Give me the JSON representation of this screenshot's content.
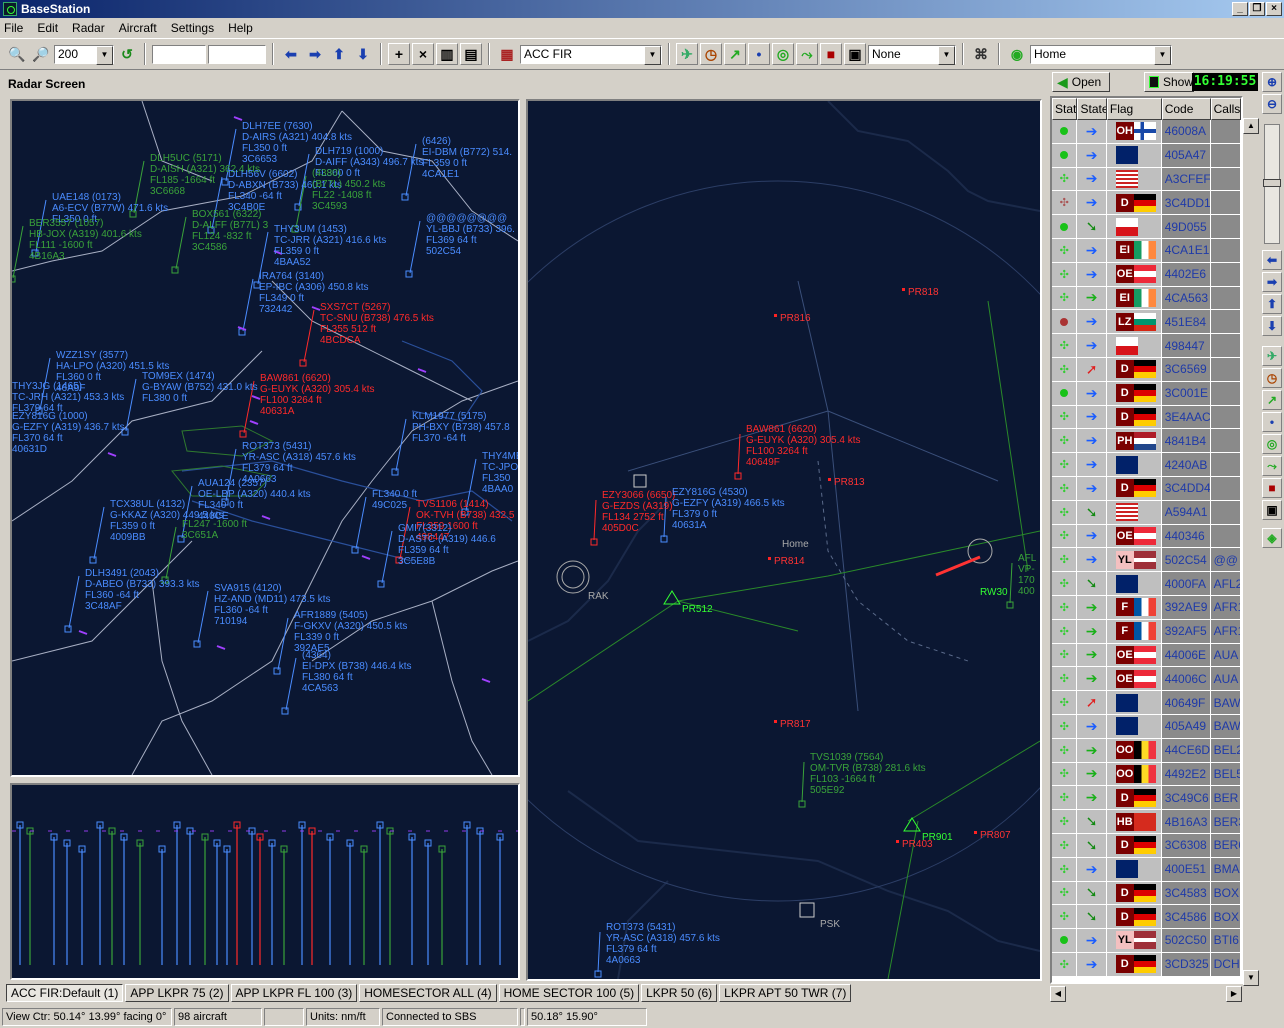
{
  "app": {
    "title": "BaseStation"
  },
  "menu": [
    "File",
    "Edit",
    "Radar",
    "Aircraft",
    "Settings",
    "Help"
  ],
  "toolbar": {
    "zoom": "200",
    "fir": "ACC FIR",
    "filter": "None",
    "location": "Home"
  },
  "radar_label": "Radar Screen",
  "open_button": "Open",
  "show_button": "Show",
  "clock": "16:19:55",
  "colors": {
    "blue": "#4a8cff",
    "green": "#3aa33a",
    "red": "#ff2a2a",
    "bg": "#0b1732"
  },
  "left_targets": [
    {
      "c": "b",
      "t": "DLH7EE (7630)\nD-AIRS (A321) 404.8 kts\nFL350 0 ft\n3C6653"
    },
    {
      "c": "b",
      "t": "DLH719 (1000)\nD-AIFF (A343) 496.7 kts\nFL360 0 ft"
    },
    {
      "c": "b",
      "t": "(6426)\nEI-DBM (B772) 514.\nFL359 0 ft\n4CA1E1"
    },
    {
      "c": "g",
      "t": "DLH5UC (5171)\nD-AISH (A321) 362.4 kts\nFL185 -1664 ft\n3C6668"
    },
    {
      "c": "b",
      "t": "DLH56V (6602)\nD-ABXN (B733) 460.1 kts\nFL340 -64 ft\n3C4B0E"
    },
    {
      "c": "g",
      "t": "(4380)\n(B77L) 450.2 kts\nFL22 -1408 ft\n3C4593"
    },
    {
      "c": "b",
      "t": "UAE148 (0173)\nA6-ECV (B77W) 471.6 kts\nFL350 0 ft"
    },
    {
      "c": "g",
      "t": "BER3557 (1057)\nHB-JOX (A319) 401.6 kts\nFL111 -1600 ft\n4B16A3"
    },
    {
      "c": "g",
      "t": "BOX561 (6322)\nD-ALFF (B77L) 3\nFL124 -832 ft\n3C4586"
    },
    {
      "c": "b",
      "t": "THY3UM (1453)\nTC-JRR (A321) 416.6 kts\nFL359 0 ft\n4BAA52"
    },
    {
      "c": "b",
      "t": "@@@@@@@@\nYL-BBJ (B733) 396.\nFL369 64 ft\n502C54"
    },
    {
      "c": "b",
      "t": "IRA764 (3140)\nEP-IBC (A306) 450.8 kts\nFL349 0 ft\n732442"
    },
    {
      "c": "r",
      "t": "SXS7CT (5267)\nTC-SNU (B738) 476.5 kts\nFL355 512 ft\n4BCDCA"
    },
    {
      "c": "b",
      "t": "WZZ1SY (3577)\nHA-LPO (A320) 451.5 kts\nFL360 0 ft\n46A9F"
    },
    {
      "c": "b",
      "t": "TOM9EX (1474)\nG-BYAW (B752) 431.0 kts\nFL380 0 ft"
    },
    {
      "c": "b",
      "t": "THY3JG (1465)\nTC-JRH (A321) 453.3 kts\nFL379 64 ft"
    },
    {
      "c": "r",
      "t": "BAW861 (6620)\nG-EUYK (A320) 305.4 kts\nFL100 3264 ft\n40631A"
    },
    {
      "c": "b",
      "t": "KLM1977 (5175)\nPH-BXY (B738) 457.8\nFL370 -64 ft"
    },
    {
      "c": "b",
      "t": "EZY816G (1000)\nG-EZFY (A319) 436.7 kts\nFL370 64 ft\n40631D"
    },
    {
      "c": "b",
      "t": "ROT373 (5431)\nYR-ASC (A318) 457.6 kts\nFL379 64 ft\n4A0663"
    },
    {
      "c": "b",
      "t": "THY4ME\nTC-JPO\nFL350\n4BAA0"
    },
    {
      "c": "b",
      "t": "AUA124 (2357)\nOE-LBP (A320) 440.4 kts\nFL340 0 ft\n440CE"
    },
    {
      "c": "b",
      "t": "FL340 0 ft\n49C025"
    },
    {
      "c": "r",
      "t": "TVS1106 (1414)\nOK-TVH (B738) 432.5\nFL359 1600 ft\n498447"
    },
    {
      "c": "b",
      "t": "TCX38UL (4132)\nG-KKAZ (A320) 449.5 kts\nFL359 0 ft\n4009BB"
    },
    {
      "c": "g",
      "t": "FL247 -1600 ft\n3C651A"
    },
    {
      "c": "b",
      "t": "GMI7(3312)\nD-ASTC (A319) 446.6\nFL359 64 ft\n3C5E8B"
    },
    {
      "c": "b",
      "t": "DLH3491 (2043)\nD-ABEO (B733) 393.3 kts\nFL360 -64 ft\n3C48AF"
    },
    {
      "c": "b",
      "t": "SVA915 (4120)\nHZ-AND (MD11) 473.5 kts\nFL360 -64 ft\n710194"
    },
    {
      "c": "b",
      "t": "AFR1889 (5405)\nF-GKXV (A320) 450.5 kts\nFL339 0 ft\n392AE5"
    },
    {
      "c": "b",
      "t": "(4364)\nEI-DPX (B738) 446.4 kts\nFL380 64 ft\n4CA563"
    }
  ],
  "right_targets": [
    {
      "c": "r",
      "t": "BAW861 (6620)\nG-EUYK (A320) 305.4 kts\nFL100 3264 ft\n40649F"
    },
    {
      "c": "r",
      "t": "EZY3066 (6650)\nG-EZDS (A319)\nFL134 2752 ft\n405D0C"
    },
    {
      "c": "b",
      "t": "EZY816G (4530)\nG-EZFY (A319) 466.5 kts\nFL379 0 ft\n40631A"
    },
    {
      "c": "g",
      "t": "TVS1039 (7564)\nOM-TVR (B738) 281.6 kts\nFL103 -1664 ft\n505E92"
    },
    {
      "c": "b",
      "t": "ROT373 (5431)\nYR-ASC (A318) 457.6 kts\nFL379 64 ft\n4A0663"
    },
    {
      "c": "g",
      "t": "AFL\nVP-\n170\n400"
    }
  ],
  "fixes": [
    "PR818",
    "PR816",
    "PR813",
    "PR814",
    "PR817",
    "PR403",
    "PR807"
  ],
  "green_fixes": [
    "PR512",
    "PR901",
    "RW30"
  ],
  "places": [
    "Home",
    "PSK",
    "RAK"
  ],
  "grid_headers": [
    "Stat",
    "State",
    "Flag",
    "Code",
    "Callsi"
  ],
  "rows": [
    {
      "st": "g",
      "sv": "b",
      "cc": "OH",
      "fl": "fi",
      "code": "46008A",
      "call": ""
    },
    {
      "st": "g",
      "sv": "b",
      "cc": "",
      "fl": "uk",
      "code": "405A47",
      "call": ""
    },
    {
      "st": "x",
      "sv": "b",
      "cc": "",
      "fl": "us",
      "code": "A3CFEF",
      "call": ""
    },
    {
      "st": "d",
      "sv": "b",
      "cc": "D",
      "fl": "de",
      "code": "3C4DD1",
      "call": ""
    },
    {
      "st": "g",
      "sv": "dg",
      "cc": "",
      "fl": "cz",
      "code": "49D055",
      "call": ""
    },
    {
      "st": "x",
      "sv": "b",
      "cc": "EI",
      "fl": "ie",
      "code": "4CA1E1",
      "call": ""
    },
    {
      "st": "x",
      "sv": "b",
      "cc": "OE",
      "fl": "at",
      "code": "4402E6",
      "call": ""
    },
    {
      "st": "x",
      "sv": "g",
      "cc": "EI",
      "fl": "ie",
      "code": "4CA563",
      "call": ""
    },
    {
      "st": "r",
      "sv": "b",
      "cc": "LZ",
      "fl": "bg",
      "code": "451E84",
      "call": ""
    },
    {
      "st": "x",
      "sv": "b",
      "cc": "",
      "fl": "cz",
      "code": "498447",
      "call": ""
    },
    {
      "st": "x",
      "sv": "r",
      "cc": "D",
      "fl": "de",
      "code": "3C6569",
      "call": ""
    },
    {
      "st": "g",
      "sv": "b",
      "cc": "D",
      "fl": "de",
      "code": "3C001E",
      "call": ""
    },
    {
      "st": "x",
      "sv": "b",
      "cc": "D",
      "fl": "de",
      "code": "3E4AAC",
      "call": ""
    },
    {
      "st": "x",
      "sv": "b",
      "cc": "PH",
      "fl": "nl",
      "code": "4841B4",
      "call": ""
    },
    {
      "st": "x",
      "sv": "b",
      "cc": "",
      "fl": "uk",
      "code": "4240AB",
      "call": ""
    },
    {
      "st": "x",
      "sv": "b",
      "cc": "D",
      "fl": "de",
      "code": "3C4DD4",
      "call": ""
    },
    {
      "st": "x",
      "sv": "dg",
      "cc": "",
      "fl": "us",
      "code": "A594A1",
      "call": ""
    },
    {
      "st": "x",
      "sv": "b",
      "cc": "OE",
      "fl": "at",
      "code": "440346",
      "call": ""
    },
    {
      "st": "x",
      "sv": "b",
      "cc": "YL",
      "fl": "lv",
      "code": "502C54",
      "call": "@@"
    },
    {
      "st": "x",
      "sv": "dg",
      "cc": "",
      "fl": "uk",
      "code": "4000FA",
      "call": "AFL2"
    },
    {
      "st": "x",
      "sv": "g",
      "cc": "F",
      "fl": "fr",
      "code": "392AE9",
      "call": "AFR1"
    },
    {
      "st": "x",
      "sv": "g",
      "cc": "F",
      "fl": "fr",
      "code": "392AF5",
      "call": "AFR1"
    },
    {
      "st": "x",
      "sv": "g",
      "cc": "OE",
      "fl": "at",
      "code": "44006E",
      "call": "AUA"
    },
    {
      "st": "x",
      "sv": "g",
      "cc": "OE",
      "fl": "at",
      "code": "44006C",
      "call": "AUA"
    },
    {
      "st": "x",
      "sv": "r",
      "cc": "",
      "fl": "uk",
      "code": "40649F",
      "call": "BAW"
    },
    {
      "st": "x",
      "sv": "b",
      "cc": "",
      "fl": "uk",
      "code": "405A49",
      "call": "BAW"
    },
    {
      "st": "x",
      "sv": "g",
      "cc": "OO",
      "fl": "be",
      "code": "44CE6D",
      "call": "BEL2"
    },
    {
      "st": "x",
      "sv": "g",
      "cc": "OO",
      "fl": "be",
      "code": "4492E2",
      "call": "BEL5"
    },
    {
      "st": "x",
      "sv": "g",
      "cc": "D",
      "fl": "de",
      "code": "3C49C6",
      "call": "BER"
    },
    {
      "st": "x",
      "sv": "dg",
      "cc": "HB",
      "fl": "ch",
      "code": "4B16A3",
      "call": "BER3"
    },
    {
      "st": "x",
      "sv": "dg",
      "cc": "D",
      "fl": "de",
      "code": "3C6308",
      "call": "BER6"
    },
    {
      "st": "x",
      "sv": "b",
      "cc": "",
      "fl": "uk",
      "code": "400E51",
      "call": "BMA"
    },
    {
      "st": "x",
      "sv": "dg",
      "cc": "D",
      "fl": "de",
      "code": "3C4583",
      "call": "BOX"
    },
    {
      "st": "x",
      "sv": "dg",
      "cc": "D",
      "fl": "de",
      "code": "3C4586",
      "call": "BOX"
    },
    {
      "st": "g",
      "sv": "b",
      "cc": "YL",
      "fl": "lv",
      "code": "502C50",
      "call": "BTI6"
    },
    {
      "st": "x",
      "sv": "b",
      "cc": "D",
      "fl": "de",
      "code": "3CD325",
      "call": "DCH"
    }
  ],
  "tabs": [
    "ACC FIR:Default (1)",
    "APP LKPR 75 (2)",
    "APP LKPR FL 100 (3)",
    "HOMESECTOR ALL (4)",
    "HOME SECTOR 100 (5)",
    "LKPR 50 (6)",
    "LKPR APT 50 TWR (7)"
  ],
  "status": [
    "View Ctr: 50.14° 13.99° facing 0°",
    "98 aircraft",
    "",
    "Units: nm/ft",
    "Connected to SBS",
    "",
    "50.18° 15.90°"
  ]
}
